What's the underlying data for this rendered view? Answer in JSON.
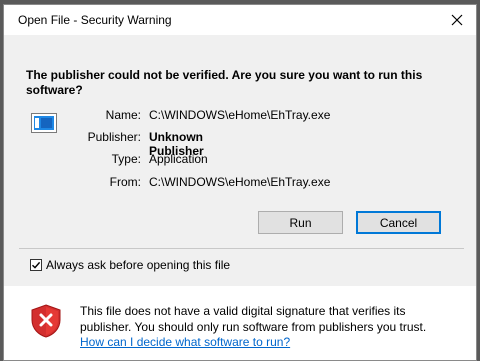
{
  "window": {
    "title": "Open File - Security Warning"
  },
  "headline": "The publisher could not be verified.  Are you sure you want to run this software?",
  "info": [
    {
      "label": "Name:",
      "value": "C:\\WINDOWS\\eHome\\EhTray.exe",
      "bold": false
    },
    {
      "label": "Publisher:",
      "value": "Unknown Publisher",
      "bold": true
    },
    {
      "label": "Type:",
      "value": "Application",
      "bold": false
    },
    {
      "label": "From:",
      "value": "C:\\WINDOWS\\eHome\\EhTray.exe",
      "bold": false
    }
  ],
  "buttons": {
    "run": "Run",
    "cancel": "Cancel"
  },
  "checkbox": {
    "label": "Always ask before opening this file",
    "checked": true
  },
  "footer": {
    "text": "This file does not have a valid digital signature that verifies its publisher.  You should only run software from publishers you trust.",
    "link": "How can I decide what software to run?"
  },
  "colors": {
    "accent": "#0078d7",
    "link": "#0066cc",
    "shield_red": "#d32f2f"
  },
  "icons": {
    "app": "application-icon",
    "shield": "security-shield-error-icon",
    "close": "close-icon"
  }
}
